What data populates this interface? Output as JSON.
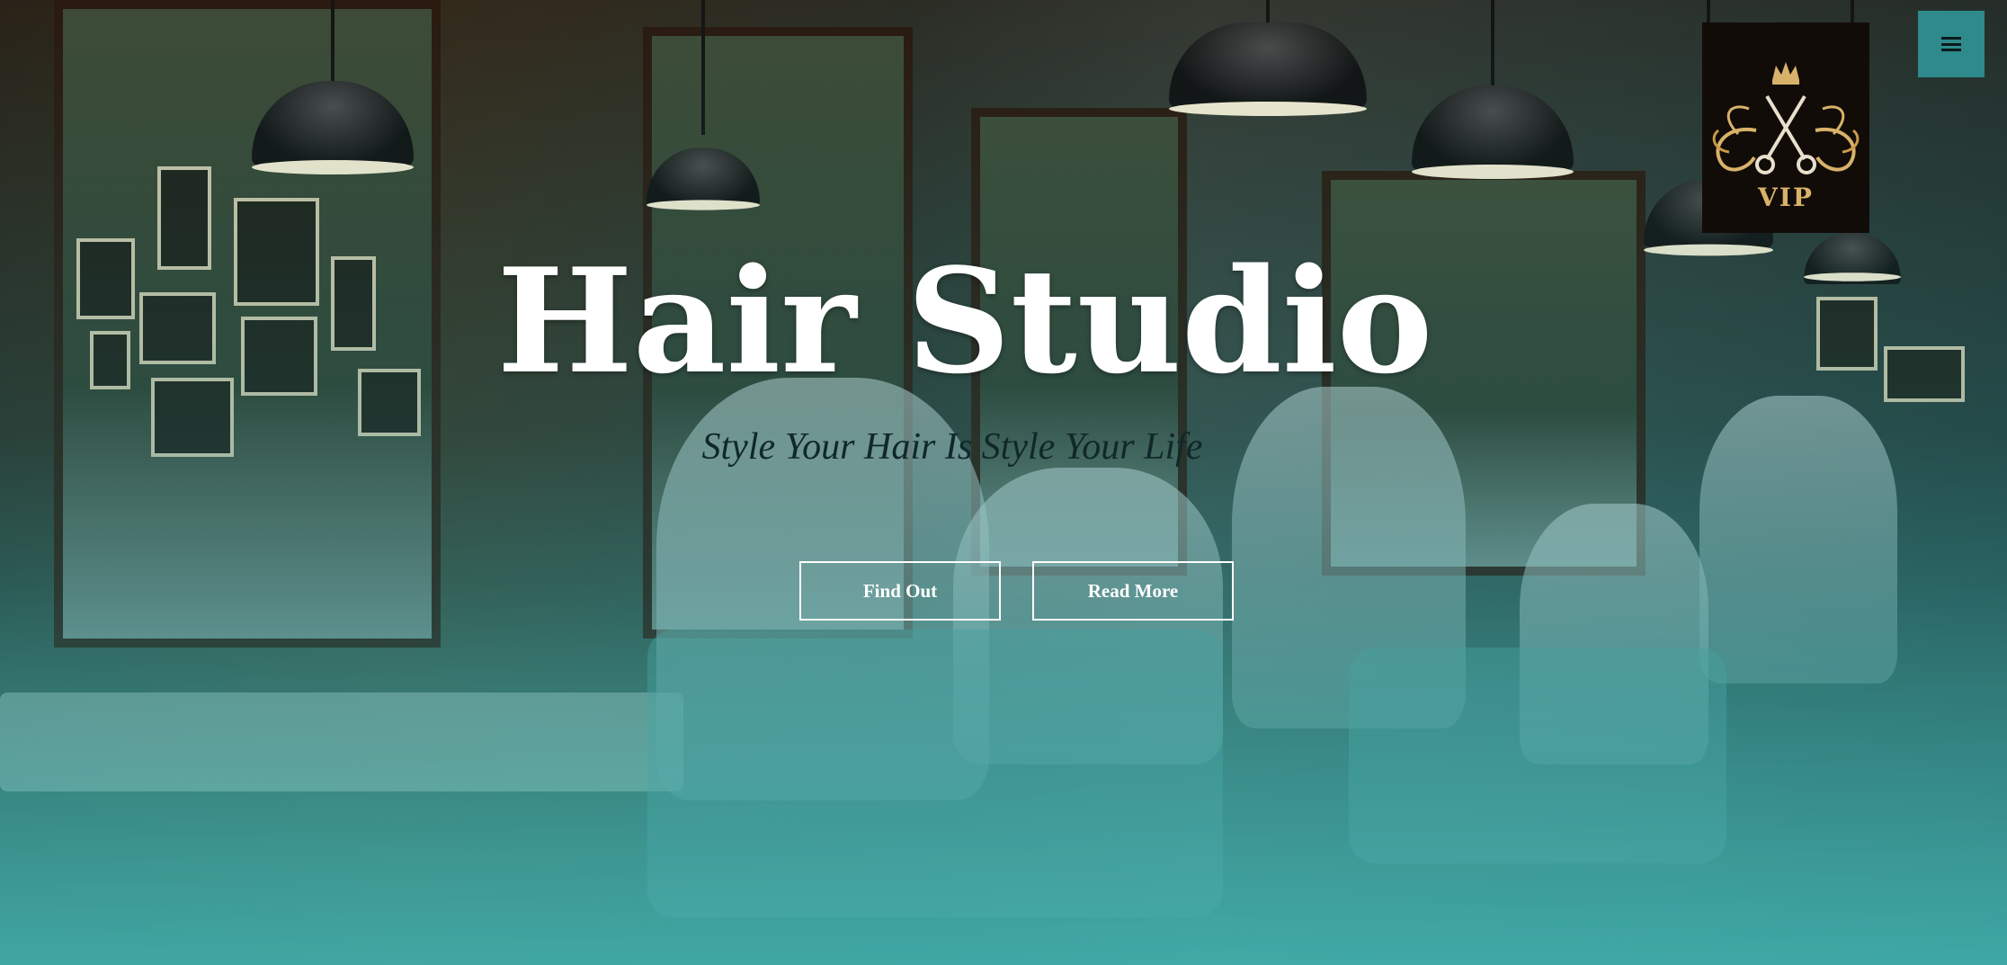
{
  "hero": {
    "title": "Hair Studio",
    "subtitle": "Style Your Hair Is Style Your Life",
    "buttons": {
      "find_out": "Find Out",
      "read_more": "Read More"
    }
  },
  "header": {
    "logo_text": "VIP",
    "menu_icon": "hamburger-icon"
  },
  "colors": {
    "accent": "#2e8a8c",
    "logo_bg": "#120c08",
    "logo_gold": "#d8b26a",
    "button_border": "#ffffff"
  }
}
